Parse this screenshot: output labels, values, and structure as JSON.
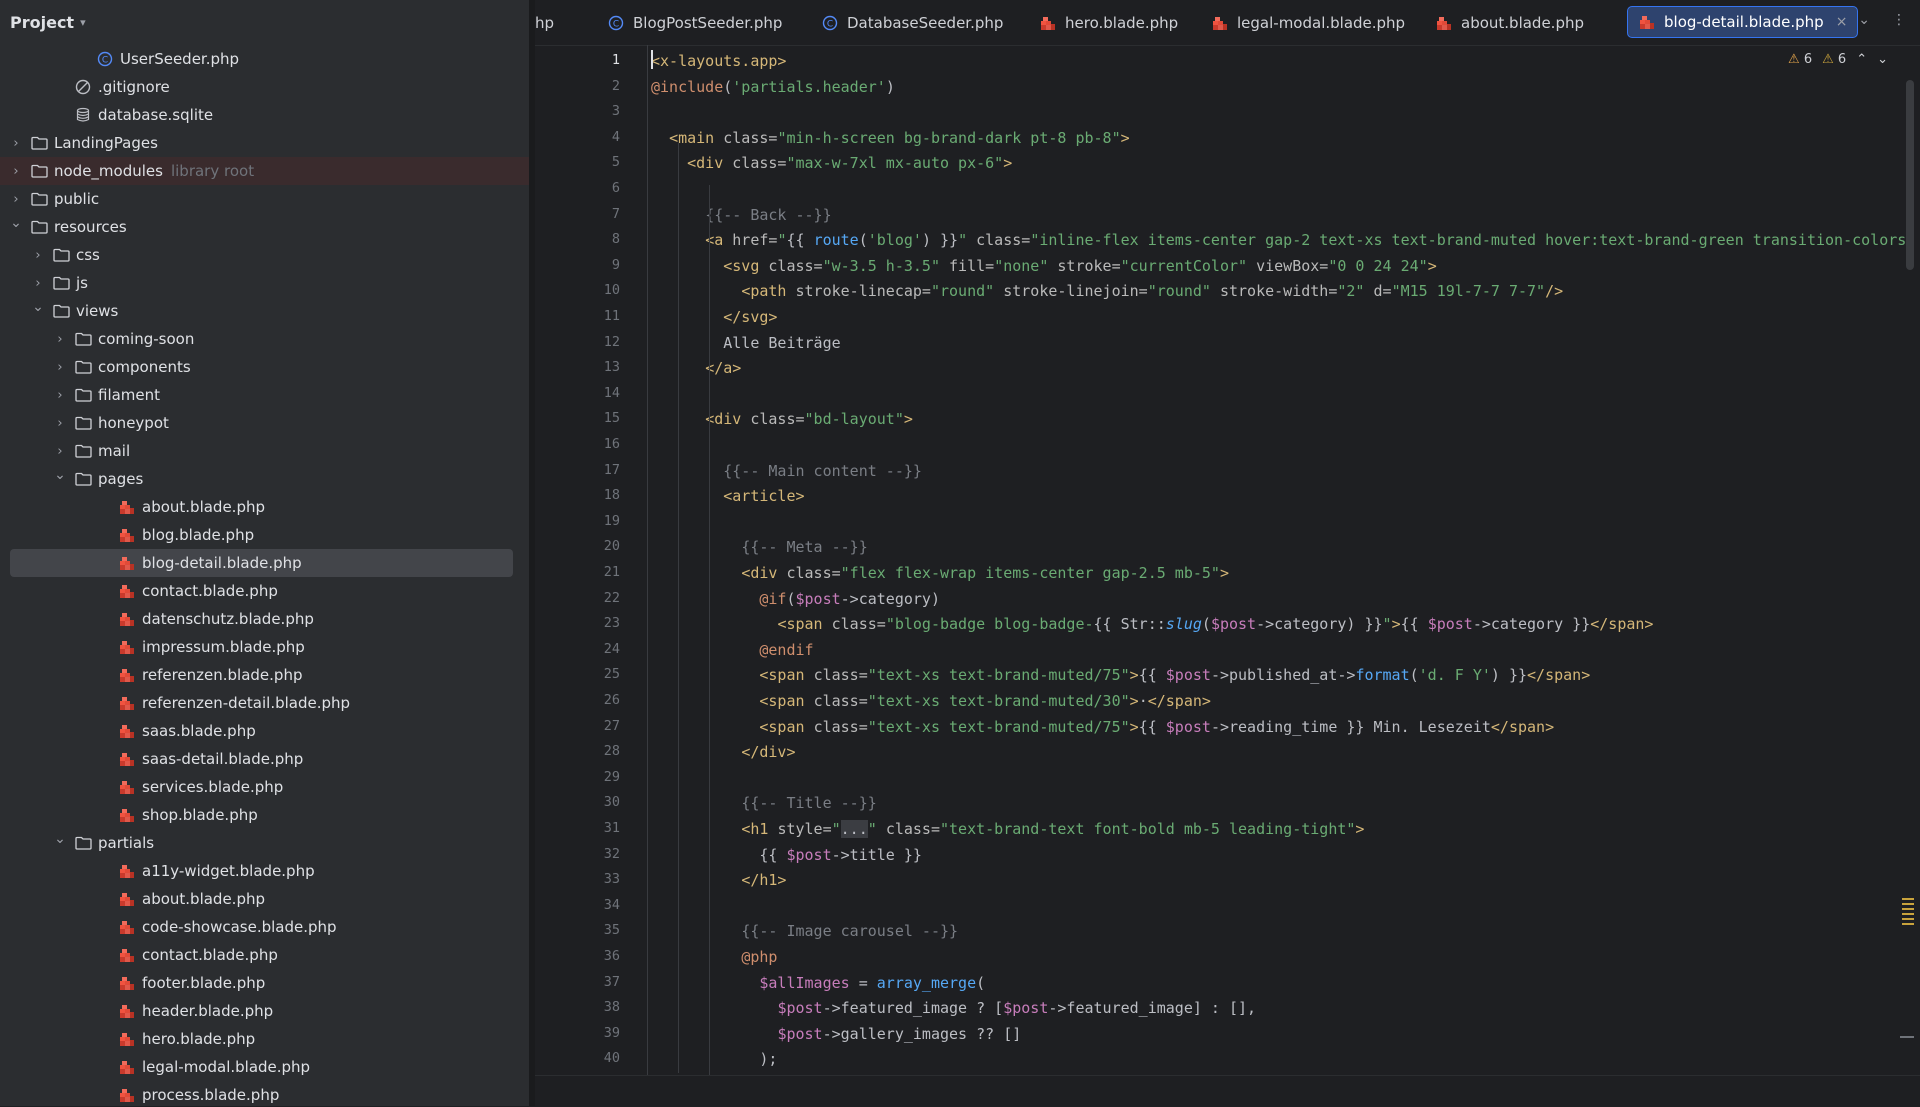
{
  "project": {
    "title": "Project",
    "tree": [
      {
        "label": "UserSeeder.php",
        "depth": 4,
        "arrow": "",
        "icon": "php-class-icon"
      },
      {
        "label": ".gitignore",
        "depth": 3,
        "arrow": "",
        "icon": "ignore-file-icon"
      },
      {
        "label": "database.sqlite",
        "depth": 3,
        "arrow": "",
        "icon": "database-icon"
      },
      {
        "label": "LandingPages",
        "depth": 1,
        "arrow": "collapsed",
        "icon": "folder-icon"
      },
      {
        "label": "node_modules",
        "note": "library root",
        "depth": 1,
        "arrow": "collapsed",
        "icon": "folder-icon",
        "lib": true
      },
      {
        "label": "public",
        "depth": 1,
        "arrow": "collapsed",
        "icon": "folder-icon"
      },
      {
        "label": "resources",
        "depth": 1,
        "arrow": "expanded",
        "icon": "folder-icon"
      },
      {
        "label": "css",
        "depth": 2,
        "arrow": "collapsed",
        "icon": "folder-icon"
      },
      {
        "label": "js",
        "depth": 2,
        "arrow": "collapsed",
        "icon": "folder-icon"
      },
      {
        "label": "views",
        "depth": 2,
        "arrow": "expanded",
        "icon": "folder-icon"
      },
      {
        "label": "coming-soon",
        "depth": 3,
        "arrow": "collapsed",
        "icon": "folder-icon"
      },
      {
        "label": "components",
        "depth": 3,
        "arrow": "collapsed",
        "icon": "folder-icon"
      },
      {
        "label": "filament",
        "depth": 3,
        "arrow": "collapsed",
        "icon": "folder-icon"
      },
      {
        "label": "honeypot",
        "depth": 3,
        "arrow": "collapsed",
        "icon": "folder-icon"
      },
      {
        "label": "mail",
        "depth": 3,
        "arrow": "collapsed",
        "icon": "folder-icon"
      },
      {
        "label": "pages",
        "depth": 3,
        "arrow": "expanded",
        "icon": "folder-icon"
      },
      {
        "label": "about.blade.php",
        "depth": 5,
        "arrow": "",
        "icon": "blade-file-icon"
      },
      {
        "label": "blog.blade.php",
        "depth": 5,
        "arrow": "",
        "icon": "blade-file-icon"
      },
      {
        "label": "blog-detail.blade.php",
        "depth": 5,
        "arrow": "",
        "icon": "blade-file-icon",
        "selected": true
      },
      {
        "label": "contact.blade.php",
        "depth": 5,
        "arrow": "",
        "icon": "blade-file-icon"
      },
      {
        "label": "datenschutz.blade.php",
        "depth": 5,
        "arrow": "",
        "icon": "blade-file-icon"
      },
      {
        "label": "impressum.blade.php",
        "depth": 5,
        "arrow": "",
        "icon": "blade-file-icon"
      },
      {
        "label": "referenzen.blade.php",
        "depth": 5,
        "arrow": "",
        "icon": "blade-file-icon"
      },
      {
        "label": "referenzen-detail.blade.php",
        "depth": 5,
        "arrow": "",
        "icon": "blade-file-icon"
      },
      {
        "label": "saas.blade.php",
        "depth": 5,
        "arrow": "",
        "icon": "blade-file-icon"
      },
      {
        "label": "saas-detail.blade.php",
        "depth": 5,
        "arrow": "",
        "icon": "blade-file-icon"
      },
      {
        "label": "services.blade.php",
        "depth": 5,
        "arrow": "",
        "icon": "blade-file-icon"
      },
      {
        "label": "shop.blade.php",
        "depth": 5,
        "arrow": "",
        "icon": "blade-file-icon"
      },
      {
        "label": "partials",
        "depth": 3,
        "arrow": "expanded",
        "icon": "folder-icon"
      },
      {
        "label": "a11y-widget.blade.php",
        "depth": 5,
        "arrow": "",
        "icon": "blade-file-icon"
      },
      {
        "label": "about.blade.php",
        "depth": 5,
        "arrow": "",
        "icon": "blade-file-icon"
      },
      {
        "label": "code-showcase.blade.php",
        "depth": 5,
        "arrow": "",
        "icon": "blade-file-icon"
      },
      {
        "label": "contact.blade.php",
        "depth": 5,
        "arrow": "",
        "icon": "blade-file-icon"
      },
      {
        "label": "footer.blade.php",
        "depth": 5,
        "arrow": "",
        "icon": "blade-file-icon"
      },
      {
        "label": "header.blade.php",
        "depth": 5,
        "arrow": "",
        "icon": "blade-file-icon"
      },
      {
        "label": "hero.blade.php",
        "depth": 5,
        "arrow": "",
        "icon": "blade-file-icon"
      },
      {
        "label": "legal-modal.blade.php",
        "depth": 5,
        "arrow": "",
        "icon": "blade-file-icon"
      },
      {
        "label": "process.blade.php",
        "depth": 5,
        "arrow": "",
        "icon": "blade-file-icon"
      }
    ]
  },
  "tabs": [
    {
      "label": "hp",
      "icon": ""
    },
    {
      "label": "BlogPostSeeder.php",
      "icon": "php-class-icon"
    },
    {
      "label": "DatabaseSeeder.php",
      "icon": "php-class-icon"
    },
    {
      "label": "hero.blade.php",
      "icon": "blade-file-icon"
    },
    {
      "label": "legal-modal.blade.php",
      "icon": "blade-file-icon"
    },
    {
      "label": "about.blade.php",
      "icon": "blade-file-icon"
    },
    {
      "label": "blog-detail.blade.php",
      "icon": "blade-file-icon",
      "active": true
    }
  ],
  "inspections": {
    "warnings_a": "6",
    "warnings_b": "6"
  },
  "editor": {
    "current_line": 1,
    "lines": [
      [
        [
          "t-tag",
          "<x-layouts.app>"
        ]
      ],
      [
        [
          "t-dir",
          "@include"
        ],
        [
          "t-txt",
          "("
        ],
        [
          "t-str",
          "'partials.header'"
        ],
        [
          "t-txt",
          ")"
        ]
      ],
      [],
      [
        [
          "t-txt",
          "  "
        ],
        [
          "t-tag",
          "<main "
        ],
        [
          "t-attr",
          "class="
        ],
        [
          "t-str",
          "\"min-h-screen bg-brand-dark pt-8 pb-8\""
        ],
        [
          "t-tag",
          ">"
        ]
      ],
      [
        [
          "t-txt",
          "    "
        ],
        [
          "t-tag",
          "<div "
        ],
        [
          "t-attr",
          "class="
        ],
        [
          "t-str",
          "\"max-w-7xl mx-auto px-6\""
        ],
        [
          "t-tag",
          ">"
        ]
      ],
      [],
      [
        [
          "t-txt",
          "      "
        ],
        [
          "t-cmt",
          "{{-- Back --}}"
        ]
      ],
      [
        [
          "t-txt",
          "      "
        ],
        [
          "t-tag",
          "<a "
        ],
        [
          "t-attr",
          "href="
        ],
        [
          "t-str",
          "\""
        ],
        [
          "t-txt",
          "{{ "
        ],
        [
          "t-fn",
          "route"
        ],
        [
          "t-txt",
          "("
        ],
        [
          "t-str",
          "'blog'"
        ],
        [
          "t-txt",
          ") }}"
        ],
        [
          "t-str",
          "\" "
        ],
        [
          "t-attr",
          "class="
        ],
        [
          "t-str",
          "\"inline-flex items-center gap-2 text-xs text-brand-muted hover:text-brand-green transition-colors"
        ]
      ],
      [
        [
          "t-txt",
          "        "
        ],
        [
          "t-tag",
          "<svg "
        ],
        [
          "t-attr",
          "class="
        ],
        [
          "t-str",
          "\"w-3.5 h-3.5\" "
        ],
        [
          "t-attr",
          "fill="
        ],
        [
          "t-str",
          "\"none\" "
        ],
        [
          "t-attr",
          "stroke="
        ],
        [
          "t-str",
          "\"currentColor\" "
        ],
        [
          "t-attr",
          "viewBox="
        ],
        [
          "t-str",
          "\"0 0 24 24\""
        ],
        [
          "t-tag",
          ">"
        ]
      ],
      [
        [
          "t-txt",
          "          "
        ],
        [
          "t-tag",
          "<path "
        ],
        [
          "t-attr",
          "stroke-linecap="
        ],
        [
          "t-str",
          "\"round\" "
        ],
        [
          "t-attr",
          "stroke-linejoin="
        ],
        [
          "t-str",
          "\"round\" "
        ],
        [
          "t-attr",
          "stroke-width="
        ],
        [
          "t-str",
          "\"2\" "
        ],
        [
          "t-attr",
          "d="
        ],
        [
          "t-str",
          "\"M15 19l-7-7 7-7\""
        ],
        [
          "t-tag",
          "/>"
        ]
      ],
      [
        [
          "t-txt",
          "        "
        ],
        [
          "t-tag",
          "</svg>"
        ]
      ],
      [
        [
          "t-txt",
          "        Alle Beiträge"
        ]
      ],
      [
        [
          "t-txt",
          "      "
        ],
        [
          "t-tag",
          "</a>"
        ]
      ],
      [],
      [
        [
          "t-txt",
          "      "
        ],
        [
          "t-tag",
          "<div "
        ],
        [
          "t-attr",
          "class="
        ],
        [
          "t-str",
          "\"bd-layout\""
        ],
        [
          "t-tag",
          ">"
        ]
      ],
      [],
      [
        [
          "t-txt",
          "        "
        ],
        [
          "t-cmt",
          "{{-- Main content --}}"
        ]
      ],
      [
        [
          "t-txt",
          "        "
        ],
        [
          "t-tag",
          "<article>"
        ]
      ],
      [],
      [
        [
          "t-txt",
          "          "
        ],
        [
          "t-cmt",
          "{{-- Meta --}}"
        ]
      ],
      [
        [
          "t-txt",
          "          "
        ],
        [
          "t-tag",
          "<div "
        ],
        [
          "t-attr",
          "class="
        ],
        [
          "t-str",
          "\"flex flex-wrap items-center gap-2.5 mb-5\""
        ],
        [
          "t-tag",
          ">"
        ]
      ],
      [
        [
          "t-txt",
          "            "
        ],
        [
          "t-dir",
          "@if"
        ],
        [
          "t-txt",
          "("
        ],
        [
          "t-var",
          "$post"
        ],
        [
          "t-txt",
          "->category)"
        ]
      ],
      [
        [
          "t-txt",
          "              "
        ],
        [
          "t-tag",
          "<span "
        ],
        [
          "t-attr",
          "class="
        ],
        [
          "t-str",
          "\"blog-badge blog-badge-"
        ],
        [
          "t-txt",
          "{{ Str::"
        ],
        [
          "t-it",
          "slug"
        ],
        [
          "t-txt",
          "("
        ],
        [
          "t-var",
          "$post"
        ],
        [
          "t-txt",
          "->category) }}"
        ],
        [
          "t-str",
          "\""
        ],
        [
          "t-tag",
          ">"
        ],
        [
          "t-txt",
          "{{ "
        ],
        [
          "t-var",
          "$post"
        ],
        [
          "t-txt",
          "->category }}"
        ],
        [
          "t-tag",
          "</span>"
        ]
      ],
      [
        [
          "t-txt",
          "            "
        ],
        [
          "t-dir",
          "@endif"
        ]
      ],
      [
        [
          "t-txt",
          "            "
        ],
        [
          "t-tag",
          "<span "
        ],
        [
          "t-attr",
          "class="
        ],
        [
          "t-str",
          "\"text-xs text-brand-muted/75\""
        ],
        [
          "t-tag",
          ">"
        ],
        [
          "t-txt",
          "{{ "
        ],
        [
          "t-var",
          "$post"
        ],
        [
          "t-txt",
          "->published_at->"
        ],
        [
          "t-fn",
          "format"
        ],
        [
          "t-txt",
          "("
        ],
        [
          "t-str",
          "'d. F Y'"
        ],
        [
          "t-txt",
          ") }}"
        ],
        [
          "t-tag",
          "</span>"
        ]
      ],
      [
        [
          "t-txt",
          "            "
        ],
        [
          "t-tag",
          "<span "
        ],
        [
          "t-attr",
          "class="
        ],
        [
          "t-str",
          "\"text-xs text-brand-muted/30\""
        ],
        [
          "t-tag",
          ">"
        ],
        [
          "t-txt",
          "·"
        ],
        [
          "t-tag",
          "</span>"
        ]
      ],
      [
        [
          "t-txt",
          "            "
        ],
        [
          "t-tag",
          "<span "
        ],
        [
          "t-attr",
          "class="
        ],
        [
          "t-str",
          "\"text-xs text-brand-muted/75\""
        ],
        [
          "t-tag",
          ">"
        ],
        [
          "t-txt",
          "{{ "
        ],
        [
          "t-var",
          "$post"
        ],
        [
          "t-txt",
          "->reading_time }} Min. Lesezeit"
        ],
        [
          "t-tag",
          "</span>"
        ]
      ],
      [
        [
          "t-txt",
          "          "
        ],
        [
          "t-tag",
          "</div>"
        ]
      ],
      [],
      [
        [
          "t-txt",
          "          "
        ],
        [
          "t-cmt",
          "{{-- Title --}}"
        ]
      ],
      [
        [
          "t-txt",
          "          "
        ],
        [
          "t-tag",
          "<h1 "
        ],
        [
          "t-attr",
          "style="
        ],
        [
          "t-str",
          "\""
        ],
        [
          "t-sel",
          "..."
        ],
        [
          "t-str",
          "\" "
        ],
        [
          "t-attr",
          "class="
        ],
        [
          "t-str",
          "\"text-brand-text font-bold mb-5 leading-tight\""
        ],
        [
          "t-tag",
          ">"
        ]
      ],
      [
        [
          "t-txt",
          "            {{ "
        ],
        [
          "t-var",
          "$post"
        ],
        [
          "t-txt",
          "->title }}"
        ]
      ],
      [
        [
          "t-txt",
          "          "
        ],
        [
          "t-tag",
          "</h1>"
        ]
      ],
      [],
      [
        [
          "t-txt",
          "          "
        ],
        [
          "t-cmt",
          "{{-- Image carousel --}}"
        ]
      ],
      [
        [
          "t-txt",
          "          "
        ],
        [
          "t-dir",
          "@php"
        ]
      ],
      [
        [
          "t-txt",
          "            "
        ],
        [
          "t-var",
          "$allImages"
        ],
        [
          "t-txt",
          " = "
        ],
        [
          "t-fn",
          "array_merge"
        ],
        [
          "t-txt",
          "("
        ]
      ],
      [
        [
          "t-txt",
          "              "
        ],
        [
          "t-var",
          "$post"
        ],
        [
          "t-txt",
          "->featured_image ? ["
        ],
        [
          "t-var",
          "$post"
        ],
        [
          "t-txt",
          "->featured_image] : [],"
        ]
      ],
      [
        [
          "t-txt",
          "              "
        ],
        [
          "t-var",
          "$post"
        ],
        [
          "t-txt",
          "->gallery_images ?? []"
        ]
      ],
      [
        [
          "t-txt",
          "            );"
        ]
      ]
    ]
  }
}
